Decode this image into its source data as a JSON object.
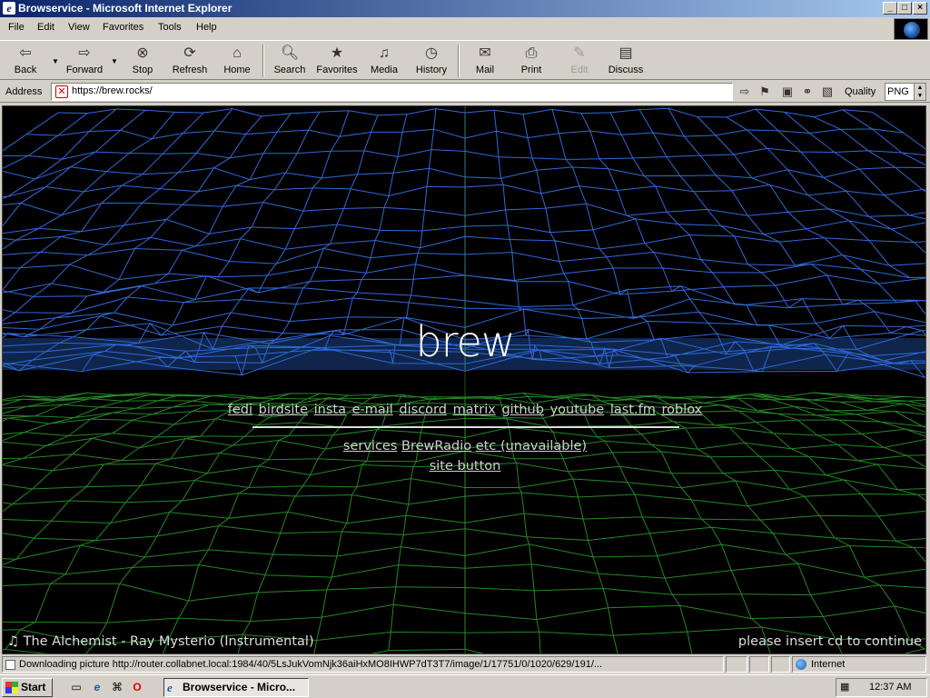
{
  "window": {
    "title": "Browservice - Microsoft Internet Explorer"
  },
  "menu": [
    "File",
    "Edit",
    "View",
    "Favorites",
    "Tools",
    "Help"
  ],
  "toolbar": {
    "back": "Back",
    "forward": "Forward",
    "stop": "Stop",
    "refresh": "Refresh",
    "home": "Home",
    "search": "Search",
    "favorites": "Favorites",
    "media": "Media",
    "history": "History",
    "mail": "Mail",
    "print": "Print",
    "edit": "Edit",
    "discuss": "Discuss"
  },
  "address": {
    "label": "Address",
    "url": "https://brew.rocks/",
    "quality_label": "Quality",
    "quality_value": "PNG"
  },
  "page": {
    "heading": "brew",
    "social_links": [
      "fedi",
      "birdsite",
      "insta",
      "e-mail",
      "discord",
      "matrix",
      "github",
      "youtube",
      "last.fm",
      "roblox"
    ],
    "secondary_links": [
      "services",
      "BrewRadio",
      "etc (unavailable)"
    ],
    "site_button": "site button",
    "now_playing": "The Alchemist - Ray Mysterio (Instrumental)",
    "insert_cd": "please insert cd to continue"
  },
  "status": {
    "message": "Downloading picture http://router.collabnet.local:1984/40/5LsJukVomNjk36aiHxMO8IHWP7dT3T7/image/1/17751/0/1020/629/191/...",
    "zone": "Internet"
  },
  "taskbar": {
    "start": "Start",
    "task": "Browservice - Micro...",
    "clock": "12:37 AM"
  },
  "colors": {
    "sky_mesh": "#3a7bff",
    "ground_mesh": "#2aa02a",
    "titlebar": "#0a246a"
  }
}
